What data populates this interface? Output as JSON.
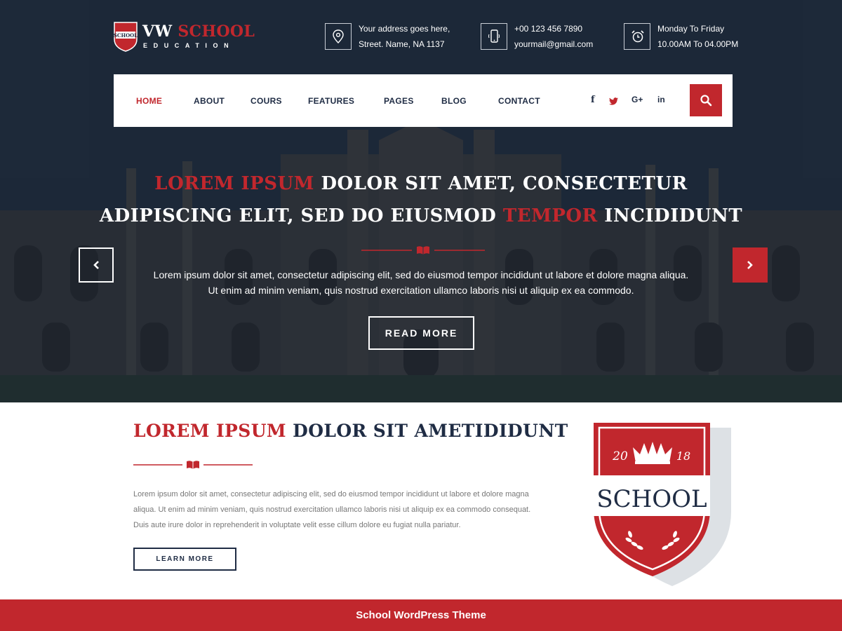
{
  "header": {
    "logo": {
      "title_white": "VW",
      "title_red": "SCHOOL",
      "subtitle": "EDUCATION",
      "shield_text": "SCHOOL"
    },
    "address": {
      "line1": "Your address goes here,",
      "line2": "Street. Name, NA 1137",
      "icon": "location-pin-icon"
    },
    "contact": {
      "line1": "+00 123 456 7890",
      "line2": "yourmail@gmail.com",
      "icon": "mobile-phone-icon"
    },
    "hours": {
      "line1": "Monday To Friday",
      "line2": "10.00AM To 04.00PM",
      "icon": "alarm-clock-icon"
    }
  },
  "nav": {
    "items": [
      {
        "label": "HOME",
        "active": true
      },
      {
        "label": "ABOUT"
      },
      {
        "label": "COURS"
      },
      {
        "label": "FEATURES"
      },
      {
        "label": "PAGES"
      },
      {
        "label": "BLOG"
      },
      {
        "label": "CONTACT"
      }
    ],
    "social": {
      "facebook": "f",
      "twitter": "twitter-icon",
      "googleplus": "G+",
      "linkedin": "in"
    },
    "search_icon": "search-icon"
  },
  "hero": {
    "line1_red": "LOREM IPSUM",
    "line1_white": "DOLOR SIT AMET, CONSECTETUR",
    "line2_white_a": "ADIPISCING ELIT, SED DO EIUSMOD",
    "line2_red": "TEMPOR",
    "line2_white_b": "INCIDIDUNT",
    "para1": "Lorem ipsum dolor sit amet, consectetur adipiscing elit, sed do eiusmod tempor incididunt ut labore et dolore magna aliqua.",
    "para2": "Ut enim ad minim veniam, quis nostrud exercitation ullamco laboris nisi ut aliquip ex ea commodo.",
    "button": "READ MORE",
    "prev_icon": "chevron-left-icon",
    "next_icon": "chevron-right-icon"
  },
  "about": {
    "title_red": "LOREM IPSUM",
    "title_dark": "DOLOR SIT AMETIDIDUNT",
    "para_lines": [
      "Lorem ipsum dolor sit amet, consectetur adipiscing elit, sed do eiusmod tempor incididunt ut labore et dolore magna",
      "aliqua. Ut enim ad minim veniam, quis nostrud exercitation ullamco laboris nisi ut aliquip ex ea commodo consequat.",
      "Duis aute irure dolor in reprehenderit in voluptate velit esse cillum dolore eu fugiat nulla pariatur."
    ],
    "button": "LEARN MORE",
    "badge": {
      "year_left": "20",
      "year_right": "18",
      "word": "SCHOOL"
    }
  },
  "footer": {
    "text": "School WordPress Theme"
  },
  "colors": {
    "accent": "#c1272d",
    "navy": "#1f2c44"
  }
}
